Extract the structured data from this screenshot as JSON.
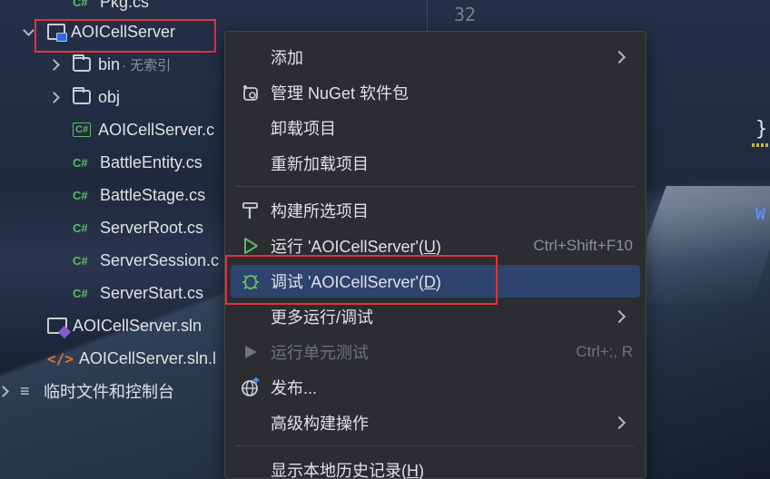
{
  "tree": {
    "top_partial": "Pkg.cs",
    "items": [
      {
        "label": "AOICellServer"
      },
      {
        "label": "bin",
        "hint": "· 无索引"
      },
      {
        "label": "obj"
      },
      {
        "label": "AOICellServer.c"
      },
      {
        "label": "BattleEntity.cs"
      },
      {
        "label": "BattleStage.cs"
      },
      {
        "label": "ServerRoot.cs"
      },
      {
        "label": "ServerSession.c"
      },
      {
        "label": "ServerStart.cs"
      },
      {
        "label": "AOICellServer.sln"
      },
      {
        "label": "AOICellServer.sln.l"
      },
      {
        "label": "临时文件和控制台"
      }
    ],
    "cs_badge": "C#",
    "xml_badge": "</>"
  },
  "editor": {
    "line_number": "32",
    "brace": "}",
    "w_char": "W"
  },
  "menu": {
    "add": "添加",
    "nuget": "管理 NuGet 软件包",
    "unload": "卸载项目",
    "reload": "重新加载项目",
    "build": "构建所选项目",
    "run_prefix": "运行 'AOICellServer'(",
    "run_key": "U",
    "run_suffix": ")",
    "run_shortcut": "Ctrl+Shift+F10",
    "debug_prefix": "调试 'AOICellServer'(",
    "debug_key": "D",
    "debug_suffix": ")",
    "more_run": "更多运行/调试",
    "unit_test": "运行单元测试",
    "unit_test_shortcut": "Ctrl+;, R",
    "publish": "发布...",
    "advanced_build": "高级构建操作",
    "history_prefix": "显示本地历史记录(",
    "history_key": "H",
    "history_suffix": ")"
  },
  "colors": {
    "menu_bg": "#2b2d30",
    "selected_bg": "#2e436e",
    "highlight_red": "#e5303a",
    "csharp_green": "#5fb865"
  }
}
